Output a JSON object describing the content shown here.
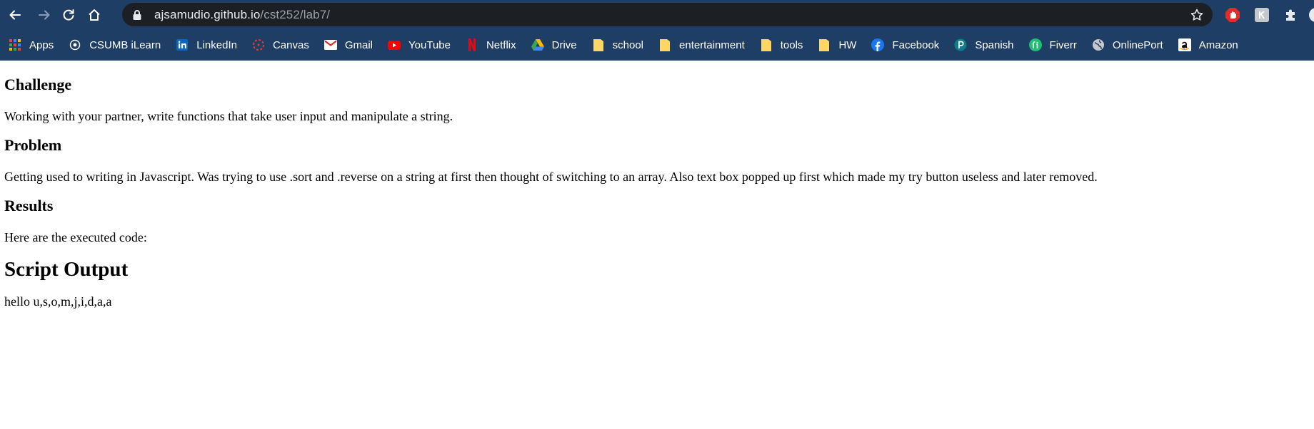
{
  "browser": {
    "url_domain": "ajsamudio.github.io",
    "url_path": "/cst252/lab7/",
    "bookmarks": [
      {
        "label": "Apps",
        "icon": "apps-grid-icon"
      },
      {
        "label": "CSUMB iLearn",
        "icon": "ilearn-icon"
      },
      {
        "label": "LinkedIn",
        "icon": "linkedin-icon"
      },
      {
        "label": "Canvas",
        "icon": "canvas-icon"
      },
      {
        "label": "Gmail",
        "icon": "gmail-icon"
      },
      {
        "label": "YouTube",
        "icon": "youtube-icon"
      },
      {
        "label": "Netflix",
        "icon": "netflix-icon"
      },
      {
        "label": "Drive",
        "icon": "drive-icon"
      },
      {
        "label": "school",
        "icon": "folder-icon"
      },
      {
        "label": "entertainment",
        "icon": "folder-icon"
      },
      {
        "label": "tools",
        "icon": "folder-icon"
      },
      {
        "label": "HW",
        "icon": "folder-icon"
      },
      {
        "label": "Facebook",
        "icon": "facebook-icon"
      },
      {
        "label": "Spanish",
        "icon": "spanish-icon"
      },
      {
        "label": "Fiverr",
        "icon": "fiverr-icon"
      },
      {
        "label": "OnlinePort",
        "icon": "globe-icon"
      },
      {
        "label": "Amazon",
        "icon": "amazon-icon"
      }
    ]
  },
  "page": {
    "challenge_heading": "Challenge",
    "challenge_text": "Working with your partner, write functions that take user input and manipulate a string.",
    "problem_heading": "Problem",
    "problem_text": "Getting used to writing in Javascript. Was trying to use .sort and .reverse on a string at first then thought of switching to an array. Also text box popped up first which made my try button useless and later removed.",
    "results_heading": "Results",
    "results_text": "Here are the executed code:",
    "output_heading": "Script Output",
    "output_text": "hello u,s,o,m,j,i,d,a,a"
  }
}
